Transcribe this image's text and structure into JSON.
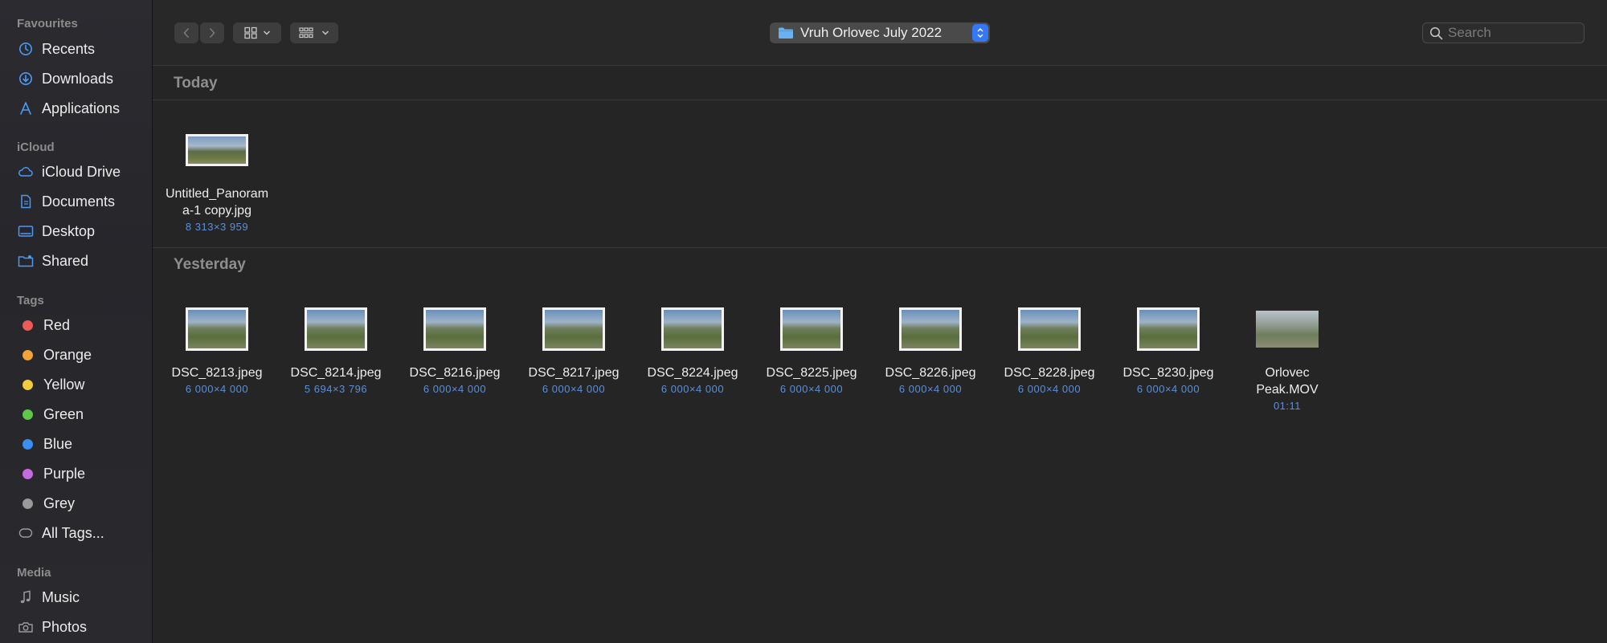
{
  "sidebar": {
    "favourites_title": "Favourites",
    "favourites": [
      {
        "label": "Recents",
        "icon": "clock-icon"
      },
      {
        "label": "Downloads",
        "icon": "download-icon"
      },
      {
        "label": "Applications",
        "icon": "applications-icon"
      }
    ],
    "icloud_title": "iCloud",
    "icloud": [
      {
        "label": "iCloud Drive",
        "icon": "cloud-icon"
      },
      {
        "label": "Documents",
        "icon": "document-icon"
      },
      {
        "label": "Desktop",
        "icon": "desktop-icon"
      },
      {
        "label": "Shared",
        "icon": "shared-folder-icon"
      }
    ],
    "tags_title": "Tags",
    "tags": [
      {
        "label": "Red",
        "color": "#ec5b57"
      },
      {
        "label": "Orange",
        "color": "#f2a33a"
      },
      {
        "label": "Yellow",
        "color": "#f2cc3a"
      },
      {
        "label": "Green",
        "color": "#5fc84a"
      },
      {
        "label": "Blue",
        "color": "#3b8ff0"
      },
      {
        "label": "Purple",
        "color": "#c46be0"
      },
      {
        "label": "Grey",
        "color": "#9a9a9a"
      }
    ],
    "all_tags": "All Tags...",
    "media_title": "Media",
    "media": [
      {
        "label": "Music",
        "icon": "music-note-icon"
      },
      {
        "label": "Photos",
        "icon": "camera-icon"
      }
    ]
  },
  "toolbar": {
    "folder_name": "Vruh Orlovec July 2022",
    "search_placeholder": "Search"
  },
  "groups": {
    "today": {
      "title": "Today",
      "files": [
        {
          "name": "Untitled_Panoram a-1 copy.jpg",
          "line1": "Untitled_Panoram",
          "line2": "a-1 copy.jpg",
          "meta": "8 313×3 959"
        }
      ]
    },
    "yesterday": {
      "title": "Yesterday",
      "files": [
        {
          "name": "DSC_8213.jpeg",
          "meta": "6 000×4 000"
        },
        {
          "name": "DSC_8214.jpeg",
          "meta": "5 694×3 796"
        },
        {
          "name": "DSC_8216.jpeg",
          "meta": "6 000×4 000"
        },
        {
          "name": "DSC_8217.jpeg",
          "meta": "6 000×4 000"
        },
        {
          "name": "DSC_8224.jpeg",
          "meta": "6 000×4 000"
        },
        {
          "name": "DSC_8225.jpeg",
          "meta": "6 000×4 000"
        },
        {
          "name": "DSC_8226.jpeg",
          "meta": "6 000×4 000"
        },
        {
          "name": "DSC_8228.jpeg",
          "meta": "6 000×4 000"
        },
        {
          "name": "DSC_8230.jpeg",
          "meta": "6 000×4 000"
        },
        {
          "name": "Orlovec Peak.MOV",
          "line1": "Orlovec",
          "line2": "Peak.MOV",
          "meta": "01:11"
        }
      ]
    }
  },
  "colors": {
    "accent": "#3478f6",
    "sidebar_icon": "#4a9af5",
    "meta_text": "#5c8fd6"
  }
}
